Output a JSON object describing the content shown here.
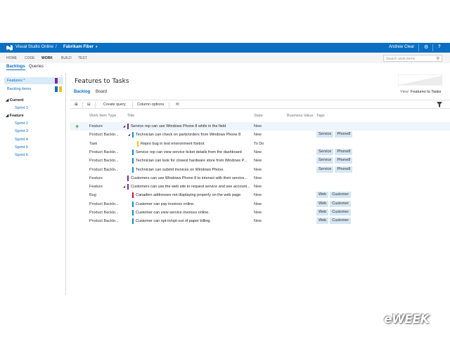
{
  "topbar": {
    "product": "Visual Studio Online",
    "separator": "/",
    "project": "Fabrikam Fiber",
    "user": "Andrew Clear",
    "help": "?"
  },
  "hubs": [
    "HOME",
    "CODE",
    "WORK",
    "BUILD",
    "TEST"
  ],
  "hub_active": "WORK",
  "search": {
    "placeholder": "Search work items"
  },
  "subnav": {
    "backlogs": "Backlogs",
    "queries": "Queries"
  },
  "left": {
    "items": [
      {
        "label": "Features *",
        "color": "#7b2c8f"
      },
      {
        "label": "Backlog items",
        "color": "#0a6fc2",
        "color2": "#f2c200"
      }
    ],
    "current_label": "Current",
    "current_sprints": [
      "Sprint 1"
    ],
    "feature_label": "Feature",
    "feature_sprints": [
      "Sprint 2",
      "Sprint 3",
      "Sprint 4",
      "Sprint 5",
      "Sprint 6"
    ]
  },
  "main": {
    "title": "Features to Tasks",
    "pivots": [
      "Backlog",
      "Board"
    ],
    "view_label": "View",
    "view_value": "Features to Tasks"
  },
  "toolbar": {
    "create_query": "Create query",
    "column_options": "Column options"
  },
  "columns": {
    "type": "Work Item Type",
    "title": "Title",
    "state": "State",
    "business_value": "Business Value",
    "tags": "Tags"
  },
  "colors": {
    "feature": "#7b2c8f",
    "pbi": "#0a8fd0",
    "task": "#f2c200",
    "bug": "#c8102e",
    "accent": "#0a6fc2"
  },
  "rows": [
    {
      "type": "Feature",
      "title": "Service rep can use Windows Phone 8 while in the field",
      "state": "New",
      "kind": "feature",
      "indent": 0,
      "expander": true,
      "tags": [],
      "highlight": true
    },
    {
      "type": "Product Backlo...",
      "title": "Technician can check on parts/orders from Windows Phone 8",
      "state": "New",
      "kind": "pbi",
      "indent": 1,
      "expander": true,
      "tags": [
        "Service",
        "Phone8"
      ]
    },
    {
      "type": "Task",
      "title": "Repro bug in test environment foxtrot",
      "state": "To Do",
      "kind": "task",
      "indent": 2,
      "expander": false,
      "tags": []
    },
    {
      "type": "Product Backlo...",
      "title": "Service rep can view service ticket details from the dashboard",
      "state": "New",
      "kind": "pbi",
      "indent": 1,
      "expander": false,
      "tags": [
        "Service",
        "Phone8"
      ]
    },
    {
      "type": "Product Backlo...",
      "title": "Technician can look for closest hardware store from Windows P...",
      "state": "New",
      "kind": "pbi",
      "indent": 1,
      "expander": false,
      "tags": [
        "Service",
        "Phone8"
      ]
    },
    {
      "type": "Product Backlo...",
      "title": "Technician can submit invoices on Windows Phone.",
      "state": "New",
      "kind": "pbi",
      "indent": 1,
      "expander": false,
      "tags": [
        "Service",
        "Phone8"
      ]
    },
    {
      "type": "Feature",
      "title": "Customers can use Windows Phone 8 to interact with their service...",
      "state": "New",
      "kind": "feature",
      "indent": 0,
      "expander": false,
      "tags": []
    },
    {
      "type": "Feature",
      "title": "Customers can use the web site to request service and see account...",
      "state": "New",
      "kind": "feature",
      "indent": 0,
      "expander": true,
      "tags": []
    },
    {
      "type": "Bug",
      "title": "Canadien addresses not displaying properly on the web page",
      "state": "New",
      "kind": "bug",
      "indent": 1,
      "expander": false,
      "tags": [
        "Web",
        "Customer"
      ]
    },
    {
      "type": "Product Backlo...",
      "title": "Customer can pay invoices online.",
      "state": "New",
      "kind": "pbi",
      "indent": 1,
      "expander": false,
      "tags": [
        "Web",
        "Customer"
      ]
    },
    {
      "type": "Product Backlo...",
      "title": "Customer can view service invoices online.",
      "state": "New",
      "kind": "pbi",
      "indent": 1,
      "expander": false,
      "tags": [
        "Web",
        "Customer"
      ]
    },
    {
      "type": "Product Backlo...",
      "title": "Customer can opt-in/opt-out of paper billing.",
      "state": "New",
      "kind": "pbi",
      "indent": 1,
      "expander": false,
      "tags": [
        "Web",
        "Customer"
      ]
    }
  ],
  "watermark": "eWEEK"
}
